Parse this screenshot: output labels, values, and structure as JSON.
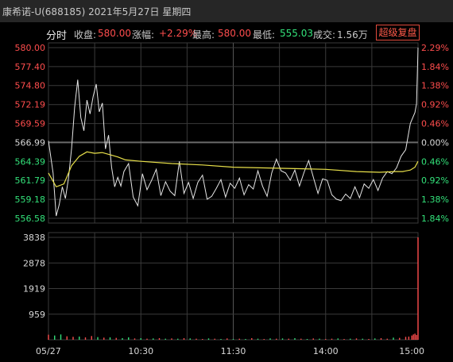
{
  "header": {
    "title": "康希诺-U(688185) 2021年5月27日 星期四"
  },
  "info": {
    "mode": "分时",
    "close_label": "收盘:",
    "close_value": "580.00",
    "change_label": "涨幅:",
    "change_value": "+2.29%",
    "high_label": "最高:",
    "high_value": "580.00",
    "low_label": "最低:",
    "low_value": "555.03",
    "volume_label": "成交:",
    "volume_value": "1.56万",
    "adjust_button": "超级复盘"
  },
  "colors": {
    "up": "#ff4d4d",
    "down": "#33e27a",
    "neutral": "#d8d8d8",
    "price_line": "#e6e6e6",
    "avg_line": "#e8e04a",
    "grid": "#3a3a3a"
  },
  "chart_data": [
    {
      "type": "line",
      "name": "price-panel",
      "x_ticks": [
        "05/27",
        "10:30",
        "11:30",
        "14:00",
        "15:00"
      ],
      "y_tick_labels": [
        "580.00",
        "577.40",
        "574.80",
        "572.19",
        "569.59",
        "566.99",
        "564.39",
        "561.79",
        "559.18",
        "556.58"
      ],
      "y_tick_values": [
        580.0,
        577.4,
        574.8,
        572.19,
        569.59,
        566.99,
        564.39,
        561.79,
        559.18,
        556.58
      ],
      "pct_labels": [
        "2.29%",
        "1.84%",
        "1.38%",
        "0.92%",
        "0.46%",
        "0.00%",
        "0.46%",
        "0.92%",
        "1.38%",
        "1.84%"
      ],
      "ylim": [
        556.58,
        580.0
      ],
      "prev_close": 566.99,
      "x_minutes": [
        0,
        3,
        5,
        7,
        9,
        11,
        13,
        15,
        17,
        19,
        21,
        23,
        25,
        27,
        29,
        31,
        33,
        35,
        37,
        39,
        41,
        43,
        45,
        47,
        49,
        52,
        55,
        58,
        61,
        64,
        67,
        70,
        73,
        76,
        79,
        82,
        85,
        88,
        91,
        94,
        97,
        100,
        103,
        106,
        109,
        112,
        115,
        118,
        121,
        124,
        127,
        130,
        133,
        136,
        139,
        142,
        145,
        148,
        151,
        154,
        157,
        160,
        163,
        166,
        169,
        172,
        175,
        178,
        181,
        184,
        187,
        190,
        193,
        196,
        199,
        202,
        205,
        208,
        211,
        214,
        217,
        220,
        223,
        226,
        229,
        232,
        235,
        238,
        239,
        240
      ],
      "price": [
        567.2,
        562.8,
        556.9,
        558.5,
        560.9,
        559.3,
        562.1,
        566.2,
        571.8,
        575.6,
        570.4,
        568.6,
        572.8,
        570.9,
        573.3,
        575.0,
        571.2,
        572.4,
        566.1,
        568.0,
        563.6,
        560.9,
        562.2,
        561.0,
        563.0,
        564.1,
        559.5,
        558.3,
        562.7,
        560.5,
        561.8,
        563.3,
        559.7,
        561.6,
        560.3,
        559.7,
        564.4,
        560.0,
        561.5,
        559.3,
        561.5,
        562.5,
        559.2,
        559.6,
        560.7,
        561.9,
        559.5,
        561.4,
        560.7,
        562.1,
        559.8,
        561.2,
        560.6,
        563.1,
        561.0,
        559.6,
        562.8,
        564.7,
        563.1,
        562.8,
        561.8,
        563.2,
        561.0,
        562.9,
        564.5,
        562.2,
        560.0,
        562.0,
        561.8,
        559.8,
        559.2,
        559.0,
        559.9,
        559.3,
        560.9,
        559.4,
        561.3,
        560.7,
        561.9,
        560.4,
        562.1,
        563.0,
        562.7,
        563.5,
        565.1,
        566.0,
        569.6,
        571.1,
        572.3,
        580.0
      ],
      "avg_x_minutes": [
        0,
        5,
        10,
        15,
        20,
        25,
        30,
        35,
        40,
        45,
        50,
        60,
        80,
        100,
        120,
        140,
        160,
        180,
        200,
        215,
        225,
        230,
        235,
        238,
        240
      ],
      "avg": [
        562.8,
        560.9,
        561.3,
        563.8,
        565.1,
        565.7,
        565.5,
        565.6,
        565.3,
        565.0,
        564.6,
        564.4,
        564.1,
        563.9,
        563.6,
        563.5,
        563.4,
        563.3,
        563.0,
        562.9,
        563.0,
        563.0,
        563.2,
        563.6,
        564.4
      ]
    },
    {
      "type": "bar",
      "name": "volume-panel",
      "y_tick_labels": [
        "3838",
        "2878",
        "1919",
        "959"
      ],
      "y_tick_values": [
        3838,
        2878,
        1919,
        959
      ],
      "ylim": [
        0,
        3838
      ],
      "x_minutes": [
        0,
        4,
        8,
        12,
        16,
        20,
        24,
        28,
        32,
        36,
        40,
        44,
        48,
        52,
        56,
        60,
        64,
        68,
        72,
        76,
        80,
        84,
        88,
        92,
        96,
        100,
        104,
        108,
        112,
        116,
        120,
        124,
        128,
        132,
        136,
        140,
        144,
        148,
        152,
        156,
        160,
        164,
        168,
        172,
        176,
        180,
        184,
        188,
        192,
        196,
        200,
        204,
        208,
        212,
        216,
        220,
        224,
        228,
        232,
        234,
        236,
        237,
        238,
        239,
        240
      ],
      "volume": [
        190,
        160,
        200,
        130,
        110,
        120,
        90,
        140,
        100,
        80,
        90,
        70,
        60,
        90,
        50,
        60,
        40,
        50,
        60,
        40,
        50,
        40,
        60,
        50,
        40,
        30,
        50,
        40,
        30,
        50,
        30,
        40,
        30,
        60,
        40,
        30,
        50,
        40,
        50,
        40,
        60,
        40,
        30,
        50,
        40,
        30,
        40,
        50,
        30,
        40,
        50,
        40,
        30,
        50,
        60,
        40,
        80,
        70,
        110,
        120,
        160,
        200,
        230,
        180,
        3838
      ],
      "volume_up": [
        true,
        false,
        false,
        true,
        true,
        false,
        true,
        true,
        false,
        true,
        false,
        true,
        false,
        false,
        true,
        false,
        true,
        false,
        true,
        false,
        true,
        false,
        true,
        false,
        true,
        true,
        false,
        true,
        false,
        true,
        false,
        true,
        false,
        true,
        false,
        true,
        false,
        true,
        false,
        true,
        false,
        true,
        false,
        true,
        false,
        true,
        true,
        false,
        true,
        false,
        true,
        false,
        true,
        false,
        true,
        true,
        false,
        true,
        true,
        true,
        true,
        true,
        true,
        true,
        true
      ]
    }
  ]
}
